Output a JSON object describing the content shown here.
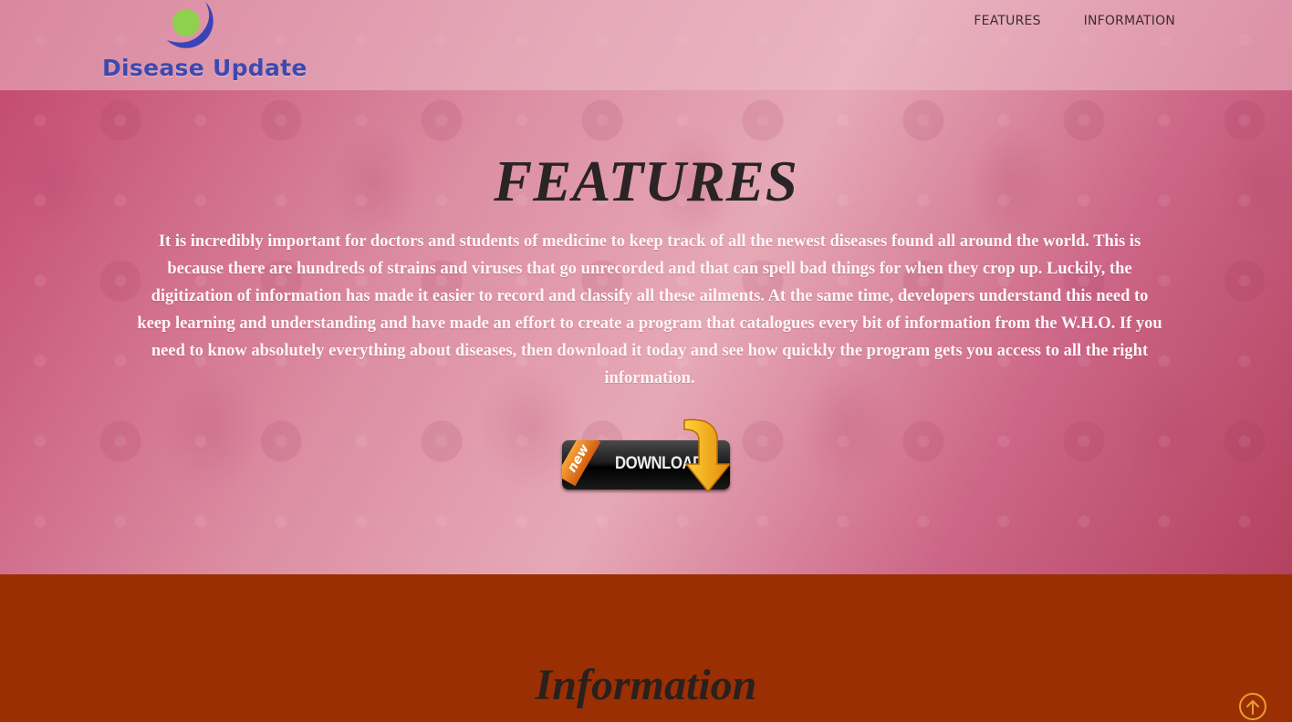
{
  "header": {
    "logo_text": "Disease Update",
    "nav": [
      {
        "label": "FEATURES"
      },
      {
        "label": "INFORMATION"
      }
    ]
  },
  "features": {
    "title": "FEATURES",
    "body": "It is incredibly important for doctors and students of medicine to keep track of all the newest diseases found all around the world. This is because there are hundreds of strains and viruses that go unrecorded and that can spell bad things for when they crop up. Luckily, the digitization of information has made it easier to record and classify all these ailments. At the same time, developers understand this need to keep learning and understanding and have made an effort to create a program that catalogues every bit of information from the W.H.O. If you need to know absolutely everything about diseases, then download it today and see how quickly the program gets you access to all the right information.",
    "download_button": {
      "badge": "new",
      "label": "DOWNLOAD",
      "icon": "download-arrow-icon"
    }
  },
  "information": {
    "title": "Information"
  },
  "scroll_top": {
    "icon": "arrow-up-circle-icon"
  },
  "colors": {
    "nav_text": "#3a2d33",
    "logo_text": "#3d49b0",
    "logo_green": "#8fd14f",
    "information_bg": "#9b2f04",
    "scroll_top_accent": "#e8a030"
  }
}
